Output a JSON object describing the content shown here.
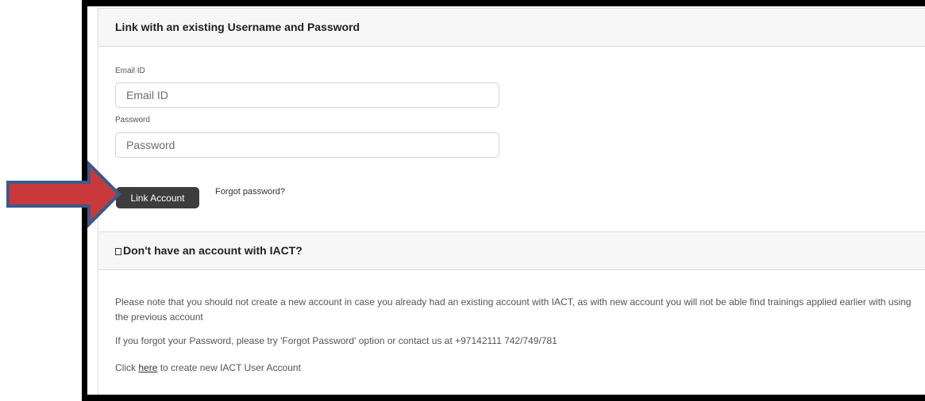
{
  "link_section": {
    "title": "Link with an existing Username and Password",
    "email_label": "Email ID",
    "email_placeholder": "Email ID",
    "email_value": "",
    "password_label": "Password",
    "password_placeholder": "Password",
    "password_value": "",
    "link_button": "Link Account",
    "forgot_link": "Forgot password?"
  },
  "register_section": {
    "title": "Don't have an account with IACT?",
    "title_icon": "checkbox-glyph-icon",
    "note": "Please note that you should not create a new account in case you already had an existing account with IACT, as with new account you will not be able find trainings applied earlier with using the previous account",
    "forgot_help": "If you forgot your Password, please try 'Forgot Password' option or contact us at +97142111 742/749/781",
    "create_prefix": "Click ",
    "create_link": "here",
    "create_suffix": " to create new IACT User Account"
  },
  "annotation": {
    "icon": "arrow-right-icon",
    "fill": "#c9393b",
    "outline": "#3a5a8c"
  }
}
